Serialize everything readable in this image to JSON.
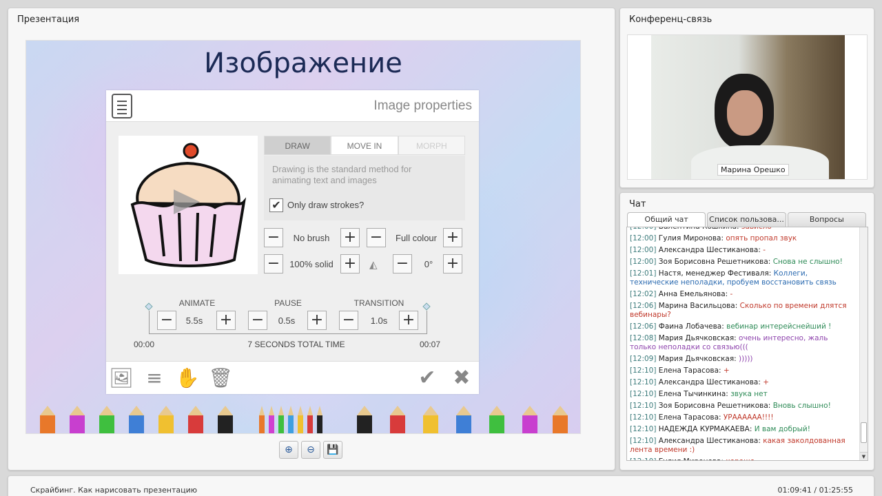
{
  "presentation": {
    "panel_title": "Презентация",
    "slide_title": "Изображение",
    "dialog": {
      "title": "Image properties",
      "tabs": [
        "DRAW",
        "MOVE IN",
        "MORPH"
      ],
      "description": "Drawing is the standard method for animating text and images",
      "checkbox_label": "Only draw strokes?",
      "checkbox_checked": true,
      "brush_label": "No brush",
      "colour_label": "Full colour",
      "opacity_label": "100% solid",
      "angle_label": "0°",
      "timeline": {
        "animate_label": "ANIMATE",
        "animate_value": "5.5s",
        "pause_label": "PAUSE",
        "pause_value": "0.5s",
        "transition_label": "TRANSITION",
        "transition_value": "1.0s",
        "start_time": "00:00",
        "total_label": "7 SECONDS TOTAL TIME",
        "end_time": "00:07"
      },
      "footer_icons": [
        "image-icon",
        "text-lines-icon",
        "hand-icon",
        "trash-icon",
        "check-icon",
        "close-icon"
      ]
    },
    "zoom_buttons": [
      "zoom-in-icon",
      "zoom-out-icon",
      "save-icon"
    ],
    "pencil_colors": [
      "#e8782a",
      "#c83fcf",
      "#3fbf3f",
      "#3f7fd6",
      "#f0c030",
      "#d83b3b",
      "#222222",
      "#e8782a",
      "#d040d0",
      "#3fbf3f",
      "#3f9fe0",
      "#f0c030",
      "#d83b3b",
      "#222222",
      "#222222",
      "#d83b3b",
      "#f0c030",
      "#3f7fd6",
      "#3fbf3f",
      "#c83fcf",
      "#e8782a"
    ]
  },
  "conference": {
    "panel_title": "Конференц-связь",
    "camera_name": "Марина Орешко"
  },
  "chat": {
    "panel_title": "Чат",
    "tabs": [
      "Общий чат",
      "Список пользова...",
      "Вопросы"
    ],
    "messages": [
      {
        "time": "[12:00]",
        "name": "Валентина Кошкина:",
        "text": "зависло",
        "color": "#c0392b"
      },
      {
        "time": "[12:00]",
        "name": "Гулия Миронова:",
        "text": "опять пропал звук",
        "color": "#c0392b"
      },
      {
        "time": "[12:00]",
        "name": "Александра Шестиканова:",
        "text": "-",
        "color": "#c0392b"
      },
      {
        "time": "[12:00]",
        "name": "Зоя Борисовна Решетникова:",
        "text": "Снова не слышно!",
        "color": "#2e8b57"
      },
      {
        "time": "[12:01]",
        "name": "Настя, менеджер Фестиваля:",
        "text": "Коллеги, технические неполадки, пробуем восстановить связь",
        "color": "#2a6ab0"
      },
      {
        "time": "[12:02]",
        "name": "Анна Емельянова:",
        "text": "-",
        "color": "#c0392b"
      },
      {
        "time": "[12:06]",
        "name": "Марина Васильцова:",
        "text": "Сколько по времени длятся вебинары?",
        "color": "#c0392b"
      },
      {
        "time": "[12:06]",
        "name": "Фаина Лобачева:",
        "text": "вебинар интерейснейший !",
        "color": "#2e8b57"
      },
      {
        "time": "[12:08]",
        "name": "Мария Дьячковская:",
        "text": "очень интересно, жаль только неполадки со связью(((",
        "color": "#8e44ad"
      },
      {
        "time": "[12:09]",
        "name": "Мария Дьячковская:",
        "text": ")))))",
        "color": "#8e44ad"
      },
      {
        "time": "[12:10]",
        "name": "Елена Тарасова:",
        "text": "+",
        "color": "#c0392b"
      },
      {
        "time": "[12:10]",
        "name": "Александра Шестиканова:",
        "text": "+",
        "color": "#c0392b"
      },
      {
        "time": "[12:10]",
        "name": "Елена Тычинкина:",
        "text": "звука нет",
        "color": "#2e8b57"
      },
      {
        "time": "[12:10]",
        "name": "Зоя Борисовна Решетникова:",
        "text": "Вновь слышно!",
        "color": "#2e8b57"
      },
      {
        "time": "[12:10]",
        "name": "Елена Тарасова:",
        "text": "УРАААААА!!!!",
        "color": "#c0392b"
      },
      {
        "time": "[12:10]",
        "name": "НАДЕЖДА КУРМАКАЕВА:",
        "text": "И вам добрый!",
        "color": "#2e8b57"
      },
      {
        "time": "[12:10]",
        "name": "Александра Шестиканова:",
        "text": "какая заколдованная лента времени :)",
        "color": "#c0392b"
      },
      {
        "time": "[12:10]",
        "name": "Гулия Миронова:",
        "text": "хорошо",
        "color": "#c0392b"
      }
    ]
  },
  "footer": {
    "title": "Скрайбинг. Как нарисовать презентацию",
    "time": "01:09:41 / 01:25:55"
  }
}
